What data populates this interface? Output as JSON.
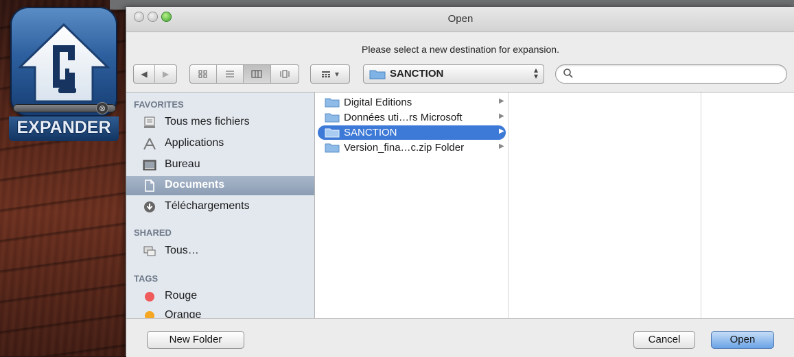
{
  "app": {
    "label": "EXPANDER",
    "icon": "clamp-house-icon",
    "progress_close": "⊗"
  },
  "dialog": {
    "title": "Open",
    "prompt": "Please select a new destination for expansion.",
    "toolbar": {
      "back": "◀",
      "forward": "▶",
      "views": [
        "icon-view",
        "list-view",
        "column-view",
        "coverflow-view"
      ],
      "active_view": "column-view",
      "arrange": "▾",
      "path": "SANCTION",
      "search_placeholder": ""
    },
    "sidebar": {
      "sections": [
        {
          "title": "FAVORITES",
          "items": [
            {
              "label": "Tous mes fichiers",
              "icon": "all-files-icon"
            },
            {
              "label": "Applications",
              "icon": "applications-icon"
            },
            {
              "label": "Bureau",
              "icon": "desktop-icon"
            },
            {
              "label": "Documents",
              "icon": "documents-icon",
              "selected": true
            },
            {
              "label": "Téléchargements",
              "icon": "downloads-icon"
            }
          ]
        },
        {
          "title": "SHARED",
          "items": [
            {
              "label": "Tous…",
              "icon": "network-icon"
            }
          ]
        },
        {
          "title": "TAGS",
          "items": [
            {
              "label": "Rouge",
              "color": "#ef5a5a"
            },
            {
              "label": "Orange",
              "color": "#f5a623"
            }
          ]
        }
      ]
    },
    "browser": {
      "column1": [
        {
          "label": "Digital Editions"
        },
        {
          "label": "Données uti…rs Microsoft"
        },
        {
          "label": "SANCTION",
          "selected": true
        },
        {
          "label": "Version_fina…c.zip Folder"
        }
      ]
    },
    "buttons": {
      "new_folder": "New Folder",
      "cancel": "Cancel",
      "open": "Open"
    }
  }
}
